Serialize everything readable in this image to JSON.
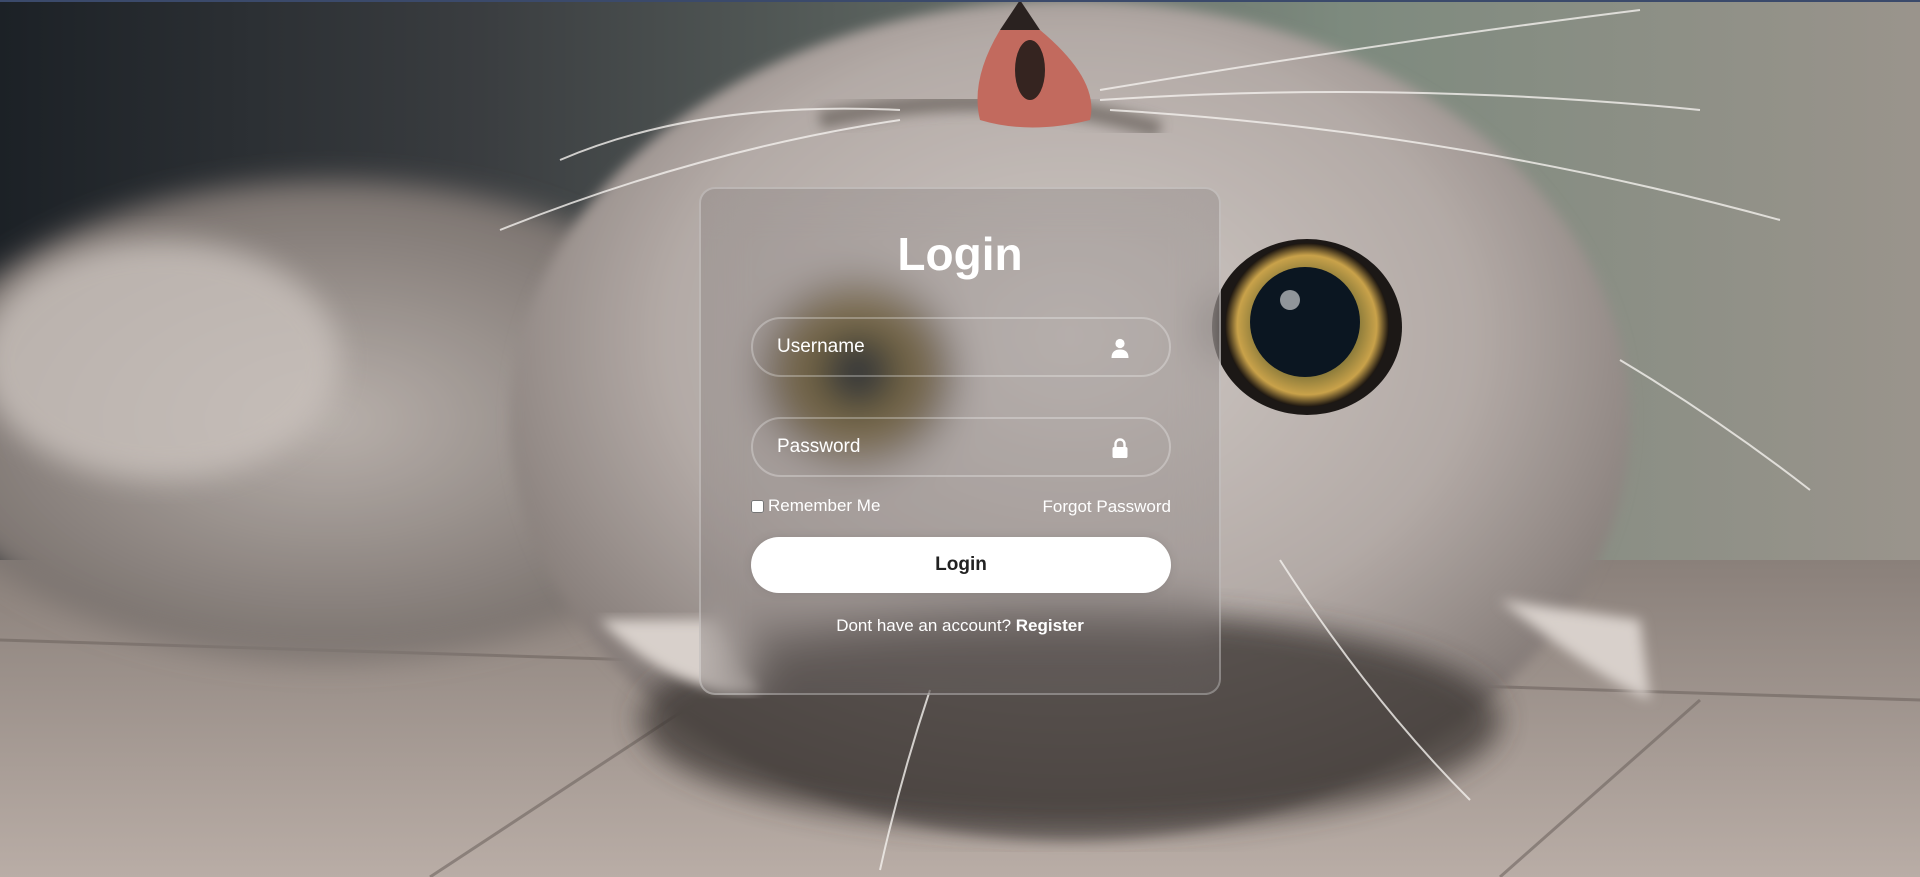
{
  "login_form": {
    "title": "Login",
    "username": {
      "placeholder": "Username",
      "icon": "user-icon"
    },
    "password": {
      "placeholder": "Password",
      "icon": "lock-icon"
    },
    "remember_label": "Remember Me",
    "forgot_label": "Forgot Password",
    "submit_label": "Login",
    "register_prompt": "Dont have an account?",
    "register_label": "Register"
  },
  "colors": {
    "card_border": "#ffffff",
    "button_bg": "#ffffff",
    "button_text": "#222222",
    "text": "#ffffff"
  }
}
